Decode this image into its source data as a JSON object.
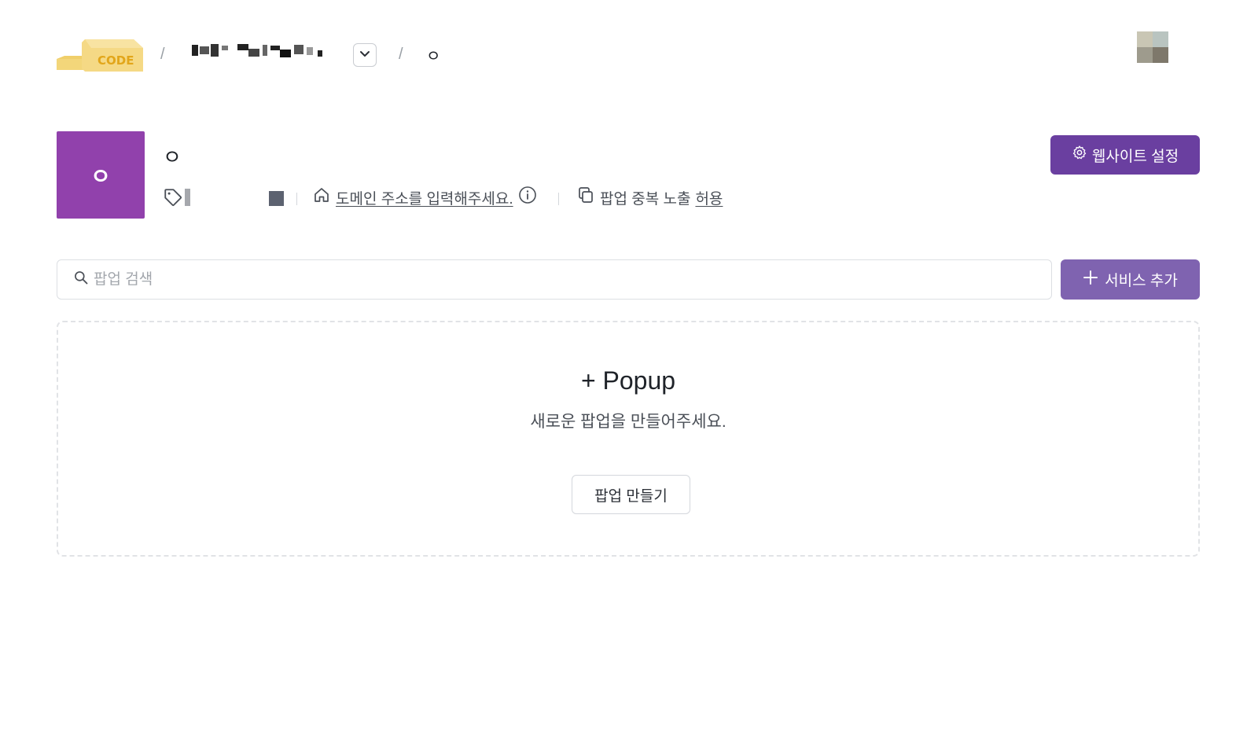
{
  "header": {
    "logo_text": "CODE",
    "breadcrumb_sep": "/",
    "current_site": "ㅇ"
  },
  "site": {
    "thumb_letter": "ㅇ",
    "name": "ㅇ",
    "domain_placeholder": "도메인 주소를 입력해주세요.",
    "dup_label": "팝업 중복 노출",
    "dup_value": "허용",
    "color": "#5c6270"
  },
  "toolbar": {
    "settings_label": "웹사이트 설정",
    "search_placeholder": "팝업 검색",
    "add_label": "서비스 추가"
  },
  "empty_state": {
    "title": "+ Popup",
    "subtitle": "새로운 팝업을 만들어주세요.",
    "create_label": "팝업 만들기"
  },
  "colors": {
    "brand_purple": "#6a3fa0",
    "add_button": "#7f63b0",
    "site_thumb": "#9141ac"
  }
}
